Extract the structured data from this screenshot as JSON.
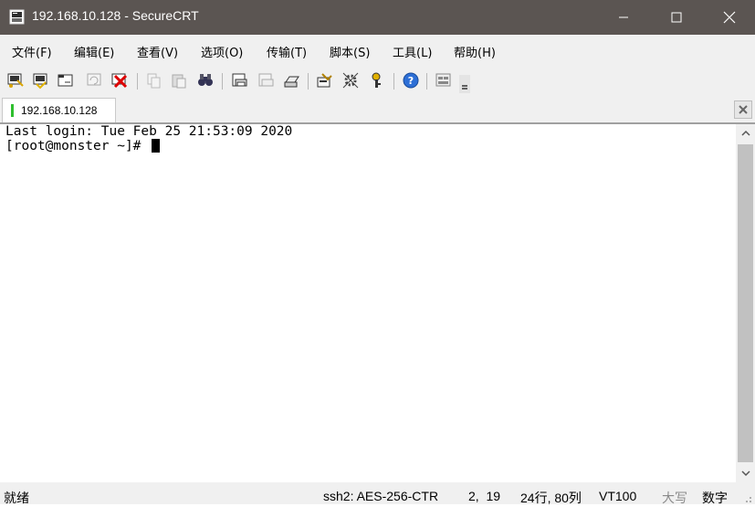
{
  "window": {
    "title": "192.168.10.128 - SecureCRT"
  },
  "menu": {
    "items": [
      {
        "label": "文件(F)"
      },
      {
        "label": "编辑(E)"
      },
      {
        "label": "查看(V)"
      },
      {
        "label": "选项(O)"
      },
      {
        "label": "传输(T)"
      },
      {
        "label": "脚本(S)"
      },
      {
        "label": "工具(L)"
      },
      {
        "label": "帮助(H)"
      }
    ]
  },
  "toolbar": {
    "icons": [
      "connect-icon",
      "quick-connect-icon",
      "connect-in-tab-icon",
      "reconnect-icon",
      "disconnect-icon",
      "copy-icon",
      "paste-icon",
      "find-icon",
      "print-icon",
      "print-selection-icon",
      "print-setup-icon",
      "session-options-icon",
      "global-options-icon",
      "keymap-icon",
      "help-icon",
      "customize-icon",
      "toolbar-overflow-icon"
    ]
  },
  "tabs": [
    {
      "label": "192.168.10.128",
      "status_color": "#2fbf2f"
    }
  ],
  "terminal": {
    "lines": [
      "Last login: Tue Feb 25 21:53:09 2020",
      "[root@monster ~]# "
    ]
  },
  "status": {
    "ready": "就绪",
    "cipher": "ssh2: AES-256-CTR",
    "cursor_pos": "2,  19",
    "dimensions": "24行, 80列",
    "emulation": "VT100",
    "caps": "大写",
    "num": "数字"
  }
}
